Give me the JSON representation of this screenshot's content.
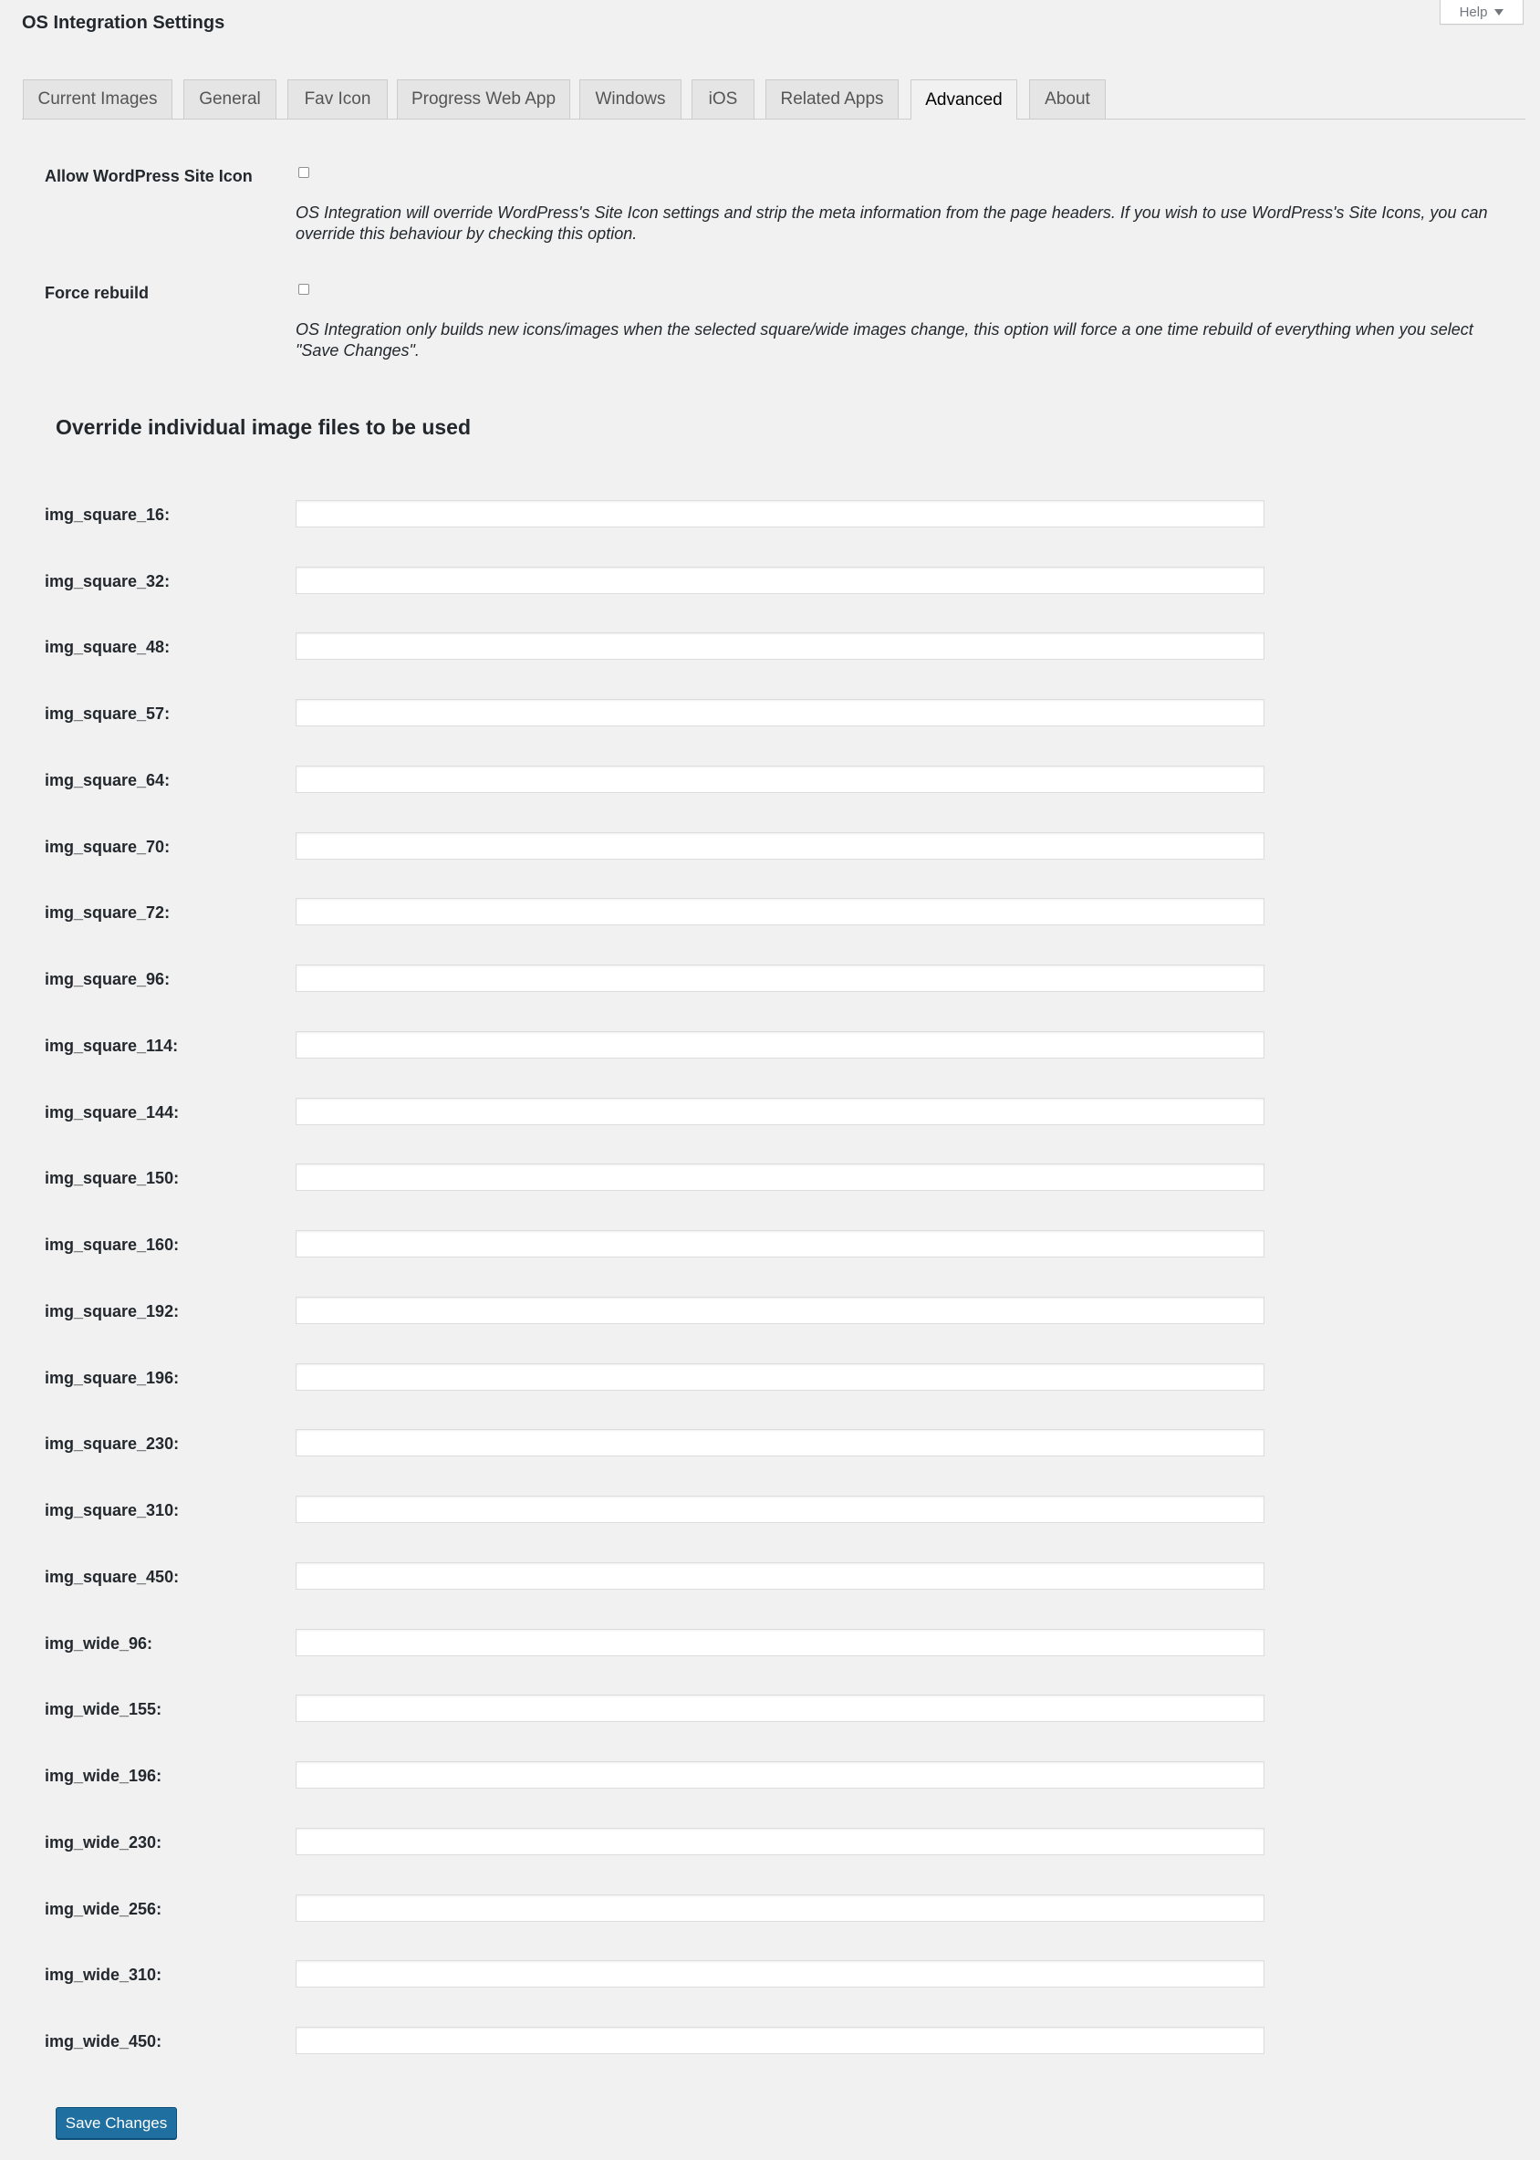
{
  "page": {
    "title": "OS Integration Settings",
    "help_label": "Help"
  },
  "tabs": [
    {
      "label": "Current Images"
    },
    {
      "label": "General"
    },
    {
      "label": "Fav Icon"
    },
    {
      "label": "Progress Web App"
    },
    {
      "label": "Windows"
    },
    {
      "label": "iOS"
    },
    {
      "label": "Related Apps"
    },
    {
      "label": "Advanced",
      "active": true
    },
    {
      "label": "About"
    }
  ],
  "settings": {
    "allow_site_icon": {
      "label": "Allow WordPress Site Icon",
      "checked": false,
      "description": "OS Integration will override WordPress's Site Icon settings and strip the meta information from the page headers. If you wish to use WordPress's Site Icons, you can override this behaviour by checking this option."
    },
    "force_rebuild": {
      "label": "Force rebuild",
      "checked": false,
      "description": "OS Integration only builds new icons/images when the selected square/wide images change, this option will force a one time rebuild of everything when you select \"Save Changes\"."
    }
  },
  "overrides": {
    "heading": "Override individual image files to be used",
    "fields": [
      {
        "label": "img_square_16:",
        "value": ""
      },
      {
        "label": "img_square_32:",
        "value": ""
      },
      {
        "label": "img_square_48:",
        "value": ""
      },
      {
        "label": "img_square_57:",
        "value": ""
      },
      {
        "label": "img_square_64:",
        "value": ""
      },
      {
        "label": "img_square_70:",
        "value": ""
      },
      {
        "label": "img_square_72:",
        "value": ""
      },
      {
        "label": "img_square_96:",
        "value": ""
      },
      {
        "label": "img_square_114:",
        "value": ""
      },
      {
        "label": "img_square_144:",
        "value": ""
      },
      {
        "label": "img_square_150:",
        "value": ""
      },
      {
        "label": "img_square_160:",
        "value": ""
      },
      {
        "label": "img_square_192:",
        "value": ""
      },
      {
        "label": "img_square_196:",
        "value": ""
      },
      {
        "label": "img_square_230:",
        "value": ""
      },
      {
        "label": "img_square_310:",
        "value": ""
      },
      {
        "label": "img_square_450:",
        "value": ""
      },
      {
        "label": "img_wide_96:",
        "value": ""
      },
      {
        "label": "img_wide_155:",
        "value": ""
      },
      {
        "label": "img_wide_196:",
        "value": ""
      },
      {
        "label": "img_wide_230:",
        "value": ""
      },
      {
        "label": "img_wide_256:",
        "value": ""
      },
      {
        "label": "img_wide_310:",
        "value": ""
      },
      {
        "label": "img_wide_450:",
        "value": ""
      }
    ]
  },
  "actions": {
    "save_label": "Save Changes"
  },
  "colors": {
    "background": "#f1f1f1",
    "primary_button": "#1f6fa0"
  }
}
